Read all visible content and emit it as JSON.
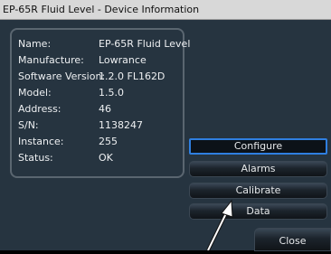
{
  "window": {
    "title": "EP-65R Fluid Level - Device Information"
  },
  "device_info": {
    "rows": [
      {
        "label": "Name:",
        "value": "EP-65R Fluid Level"
      },
      {
        "label": "Manufacture:",
        "value": "Lowrance"
      },
      {
        "label": "Software Version:",
        "value": "1.2.0 FL162D"
      },
      {
        "label": "Model:",
        "value": "1.5.0"
      },
      {
        "label": "Address:",
        "value": "46"
      },
      {
        "label": "S/N:",
        "value": "1138247"
      },
      {
        "label": "Instance:",
        "value": "255"
      },
      {
        "label": "Status:",
        "value": "OK"
      }
    ]
  },
  "buttons": {
    "configure": "Configure",
    "alarms": "Alarms",
    "calibrate": "Calibrate",
    "data": "Data",
    "close": "Close"
  },
  "colors": {
    "background": "#263440",
    "titlebar": "#d8d8d8",
    "selection_border": "#2f7fe0"
  }
}
